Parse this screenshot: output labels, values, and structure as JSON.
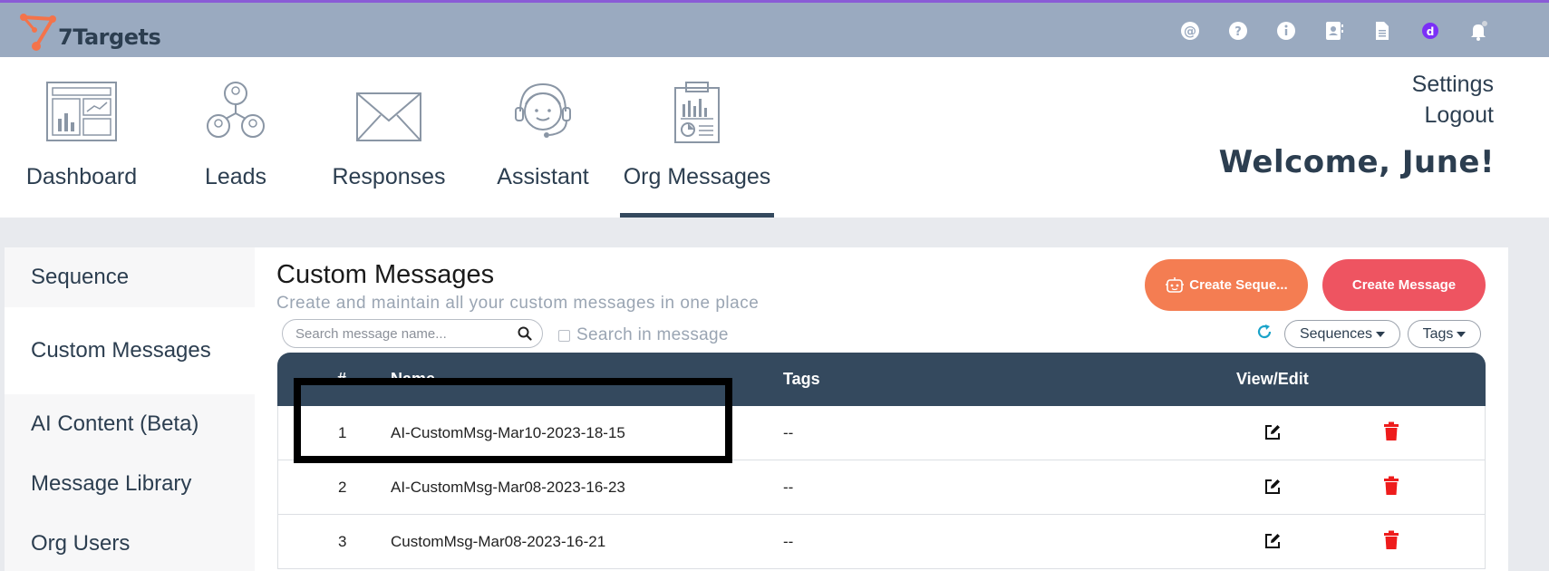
{
  "app": {
    "name": "7Targets",
    "brand_color": "#f4734a",
    "accent": "#8a5cd6"
  },
  "topbar": {
    "icons": [
      "at-icon",
      "help-icon",
      "info-icon",
      "contacts-icon",
      "document-icon",
      "user-badge-icon",
      "bell-icon"
    ]
  },
  "nav": {
    "items": [
      {
        "label": "Dashboard",
        "icon": "dashboard-icon"
      },
      {
        "label": "Leads",
        "icon": "leads-icon"
      },
      {
        "label": "Responses",
        "icon": "envelope-icon"
      },
      {
        "label": "Assistant",
        "icon": "headset-icon"
      },
      {
        "label": "Org Messages",
        "icon": "clipboard-chart-icon",
        "active": true
      }
    ],
    "settings": "Settings",
    "logout": "Logout",
    "welcome": "Welcome, June!"
  },
  "sidebar": {
    "items": [
      {
        "label": "Sequence"
      },
      {
        "label": "Custom Messages",
        "active": true
      },
      {
        "label": "AI Content (Beta)"
      },
      {
        "label": "Message Library"
      },
      {
        "label": "Org Users"
      }
    ]
  },
  "main": {
    "title": "Custom Messages",
    "subtitle": "Create and maintain all your custom messages in one place",
    "create_sequence_label": "Create Seque...",
    "create_message_label": "Create Message",
    "search_placeholder": "Search message name...",
    "search_value": "",
    "search_in_message_label": "Search in message",
    "search_in_message_checked": false,
    "sequences_filter": "Sequences",
    "tags_filter": "Tags"
  },
  "table": {
    "headers": {
      "num": "#",
      "name": "Name",
      "tags": "Tags",
      "view_edit": "View/Edit"
    },
    "rows": [
      {
        "num": "1",
        "name": "AI-CustomMsg-Mar10-2023-18-15",
        "tags": "--"
      },
      {
        "num": "2",
        "name": "AI-CustomMsg-Mar08-2023-16-23",
        "tags": "--"
      },
      {
        "num": "3",
        "name": "CustomMsg-Mar08-2023-16-21",
        "tags": "--"
      }
    ]
  }
}
